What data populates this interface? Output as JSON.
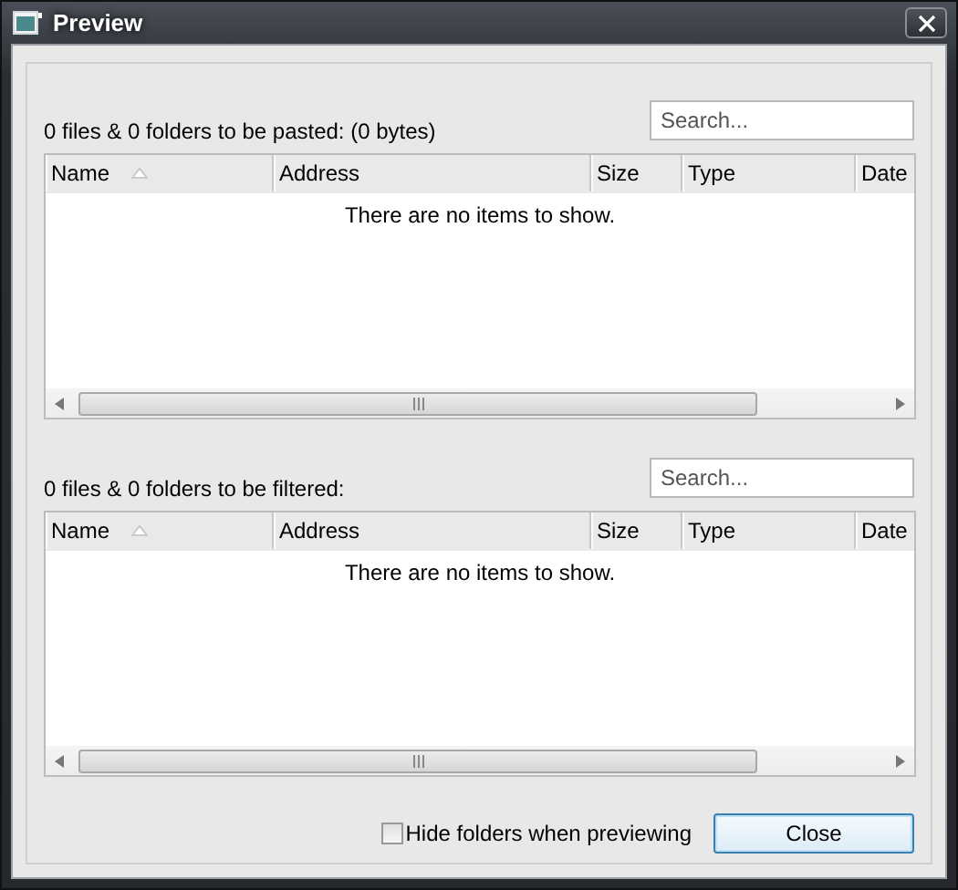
{
  "window": {
    "title": "Preview"
  },
  "sections": [
    {
      "label": "0 files & 0 folders to be pasted: (0 bytes)",
      "search": {
        "placeholder": "Search..."
      },
      "columns": [
        {
          "label": "Name",
          "sorted": true
        },
        {
          "label": "Address",
          "sorted": false
        },
        {
          "label": "Size",
          "sorted": false
        },
        {
          "label": "Type",
          "sorted": false
        },
        {
          "label": "Date",
          "sorted": false
        }
      ],
      "empty_message": "There are no items to show."
    },
    {
      "label": "0 files & 0 folders to be filtered:",
      "search": {
        "placeholder": "Search..."
      },
      "columns": [
        {
          "label": "Name",
          "sorted": true
        },
        {
          "label": "Address",
          "sorted": false
        },
        {
          "label": "Size",
          "sorted": false
        },
        {
          "label": "Type",
          "sorted": false
        },
        {
          "label": "Date",
          "sorted": false
        }
      ],
      "empty_message": "There are no items to show."
    }
  ],
  "hide_folders": {
    "label": "Hide folders when previewing",
    "checked": false
  },
  "buttons": [
    "Close"
  ]
}
